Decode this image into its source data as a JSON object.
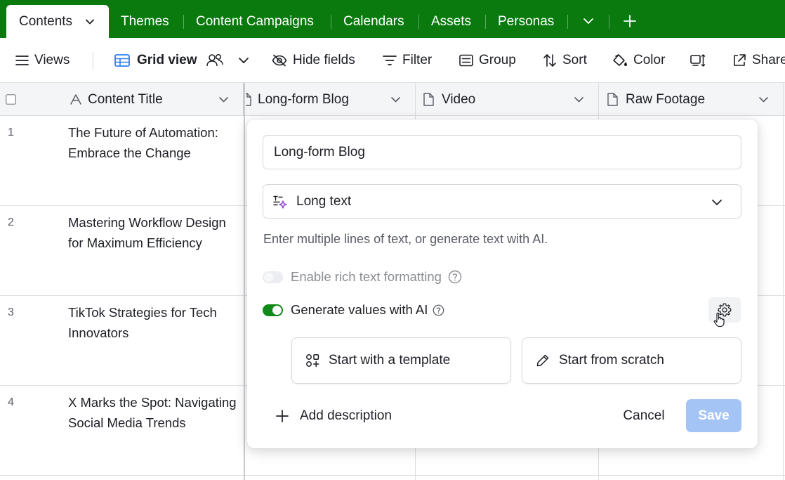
{
  "tabs": {
    "active": "Contents",
    "items": [
      "Themes",
      "Content Campaigns",
      "Calendars",
      "Assets",
      "Personas"
    ]
  },
  "toolbar": {
    "views": "Views",
    "grid_view": "Grid view",
    "hide_fields": "Hide fields",
    "filter": "Filter",
    "group": "Group",
    "sort": "Sort",
    "color": "Color",
    "share": "Share"
  },
  "columns": [
    "Content Title",
    "Long-form Blog",
    "Video",
    "Raw Footage"
  ],
  "rows": [
    {
      "num": "1",
      "title": "The Future of Automation: Embrace the Change"
    },
    {
      "num": "2",
      "title": "Mastering Workflow Design for Maximum Efficiency"
    },
    {
      "num": "3",
      "title": "TikTok Strategies for Tech Innovators"
    },
    {
      "num": "4",
      "title": "X Marks the Spot: Navigating Social Media Trends"
    }
  ],
  "popup": {
    "field_name": "Long-form Blog",
    "field_type": "Long text",
    "helper_text": "Enter multiple lines of text, or generate text with AI.",
    "rich_text_label": "Enable rich text formatting",
    "rich_text_enabled": false,
    "ai_label": "Generate values with AI",
    "ai_enabled": true,
    "template_option": "Start with a template",
    "scratch_option": "Start from scratch",
    "add_description": "Add description",
    "cancel": "Cancel",
    "save": "Save"
  },
  "colors": {
    "tabbar": "#0a7a0e",
    "toggle_on": "#128a1a",
    "save_button": "#a5c4f6",
    "grid_icon": "#2d7ff9"
  }
}
